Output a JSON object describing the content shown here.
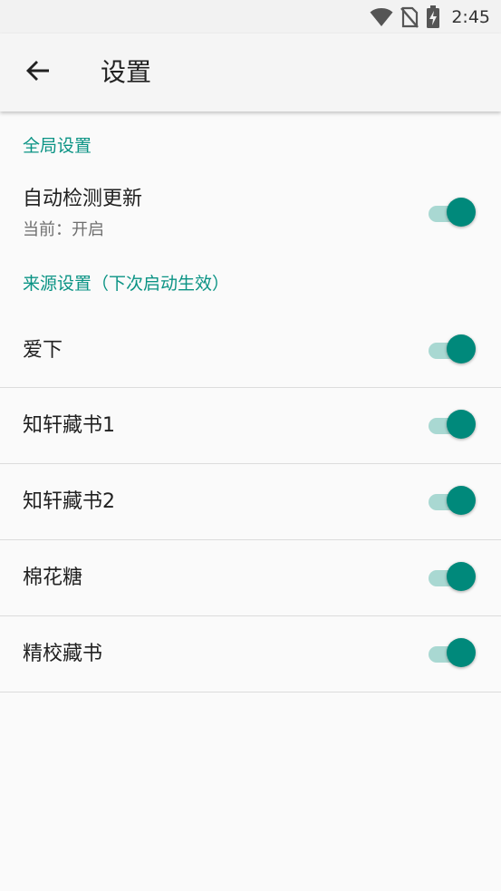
{
  "status_bar": {
    "time": "2:45",
    "icons": [
      "wifi-icon",
      "no-sim-icon",
      "battery-charging-icon"
    ]
  },
  "app_bar": {
    "back_icon": "arrow-back-icon",
    "title": "设置"
  },
  "global_section": {
    "header": "全局设置",
    "auto_update": {
      "title": "自动检测更新",
      "subtitle": "当前：开启",
      "enabled": true
    }
  },
  "sources_section": {
    "header": "来源设置（下次启动生效）",
    "items": [
      {
        "label": "爱下",
        "enabled": true
      },
      {
        "label": "知轩藏书1",
        "enabled": true
      },
      {
        "label": "知轩藏书2",
        "enabled": true
      },
      {
        "label": "棉花糖",
        "enabled": true
      },
      {
        "label": "精校藏书",
        "enabled": true
      }
    ]
  },
  "colors": {
    "accent": "#00897b",
    "accent_track": "#a9d8d2",
    "section_header": "#0a9384",
    "background": "#fafafa"
  }
}
